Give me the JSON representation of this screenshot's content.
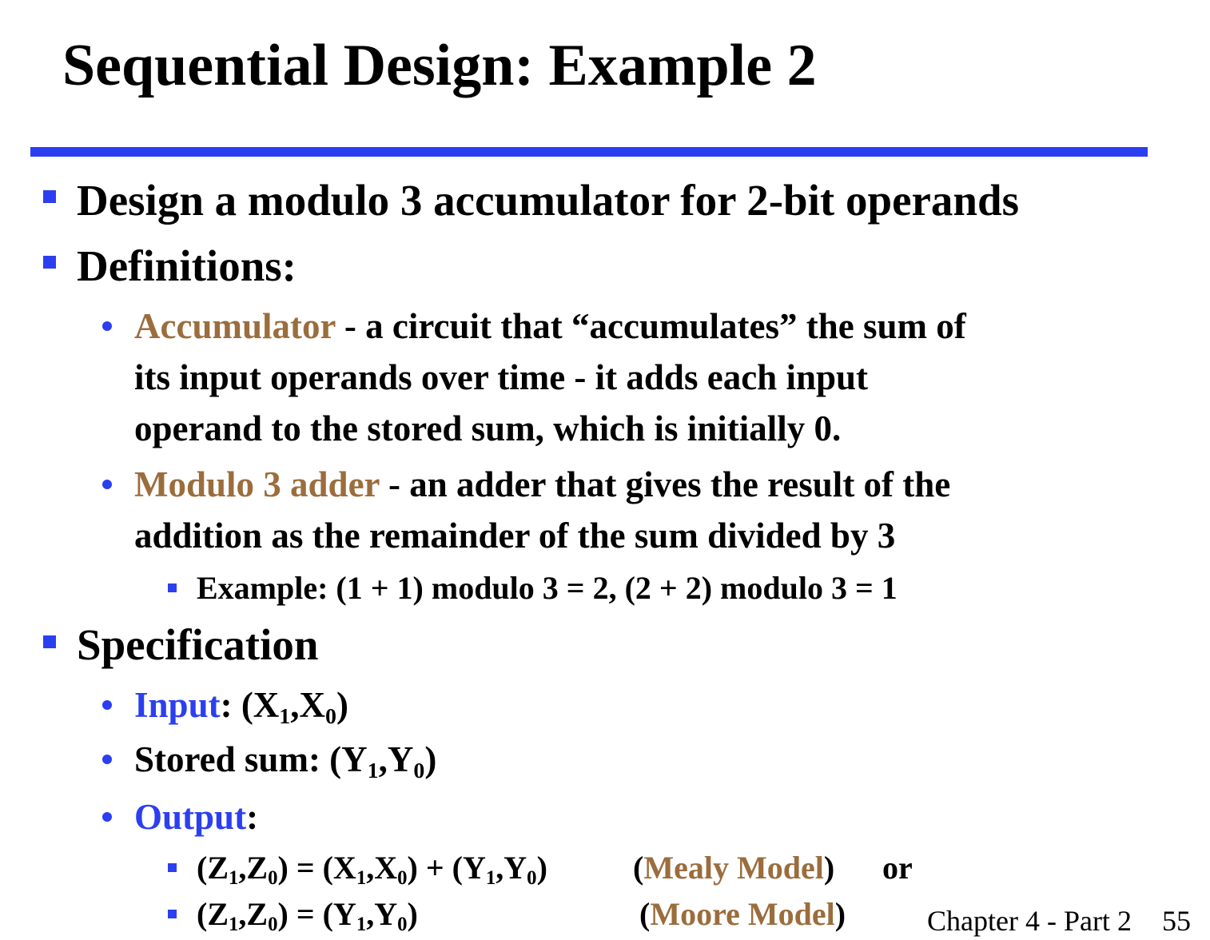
{
  "title": "Sequential Design: Example 2",
  "bullets": {
    "design": "Design a modulo 3 accumulator for 2-bit operands",
    "definitions": "Definitions:",
    "accumulator_term": "Accumulator",
    "accumulator_line1": " - a circuit that “accumulates” the sum of",
    "accumulator_line2": "its input operands over time - it adds each input",
    "accumulator_line3": "operand to the stored sum, which is initially 0.",
    "modadder_term": "Modulo 3 adder",
    "modadder_line1": " - an adder that gives the result of the",
    "modadder_line2": "addition as the remainder of the sum divided by 3",
    "example": "Example: (1 + 1) modulo 3 = 2,  (2 + 2) modulo 3 = 1",
    "specification": "Specification",
    "input_term": "Input",
    "stored_label": "Stored sum: (Y",
    "output_term": "Output",
    "mealy_model": "Mealy Model",
    "moore_model": "Moore Model",
    "or_word": "or"
  },
  "footer": {
    "chapter": "Chapter 4 - Part 2",
    "page": "55"
  },
  "colors": {
    "accent_blue": "#2b3ff0",
    "term_brown": "#9b6d3d"
  }
}
